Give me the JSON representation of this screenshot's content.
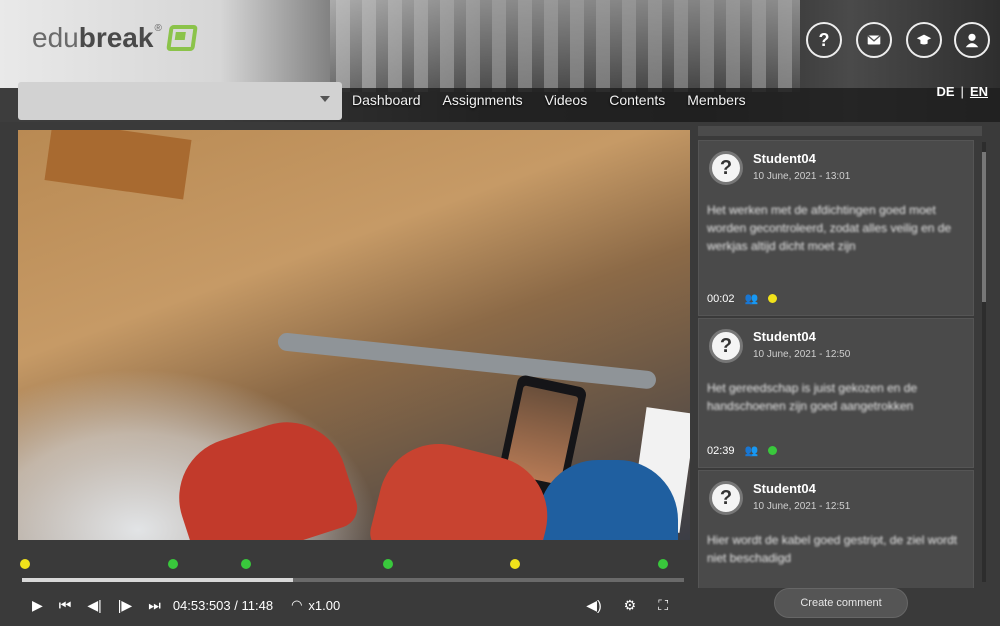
{
  "logo": {
    "part1": "edu",
    "part2": "break",
    "reg": "®"
  },
  "course_select": {
    "value": ""
  },
  "nav": [
    "Dashboard",
    "Assignments",
    "Videos",
    "Contents",
    "Members"
  ],
  "lang": {
    "de": "DE",
    "sep": "|",
    "en": "EN"
  },
  "header_icons": [
    "help-icon",
    "mail-icon",
    "academic-cap-icon",
    "user-profile-icon"
  ],
  "video": {
    "time_current": "04:53:503",
    "time_total": "11:48",
    "speed": "x1.00",
    "progress_fraction": 0.41,
    "markers": [
      {
        "position": 0.01,
        "color": "#f1e21b"
      },
      {
        "position": 0.23,
        "color": "#39c83c"
      },
      {
        "position": 0.34,
        "color": "#39c83c"
      },
      {
        "position": 0.55,
        "color": "#39c83c"
      },
      {
        "position": 0.74,
        "color": "#f1e21b"
      },
      {
        "position": 0.96,
        "color": "#39c83c"
      }
    ]
  },
  "comments": [
    {
      "author": "Student04",
      "date": "10 June, 2021 - 13:01",
      "text": "Het werken met de afdichtingen goed moet worden gecontroleerd, zodat alles veilig en de werkjas altijd dicht moet zijn",
      "time": "00:02",
      "dot_color": "#f1e21b"
    },
    {
      "author": "Student04",
      "date": "10 June, 2021 - 12:50",
      "text": "Het gereedschap is juist gekozen en de handschoenen zijn goed aangetrokken",
      "time": "02:39",
      "dot_color": "#39c83c"
    },
    {
      "author": "Student04",
      "date": "10 June, 2021 - 12:51",
      "text": "Hier wordt de kabel goed gestript, de ziel wordt niet beschadigd",
      "time": "",
      "dot_color": ""
    }
  ],
  "create_comment": "Create comment"
}
